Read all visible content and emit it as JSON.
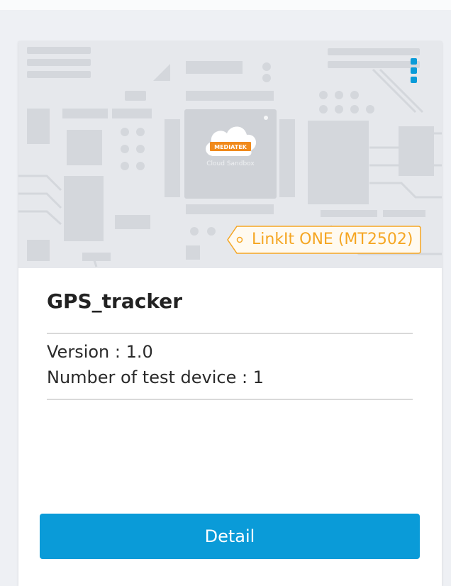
{
  "project": {
    "name": "GPS_tracker",
    "board_label": "LinkIt ONE (MT2502)",
    "logo_brand": "MEDIATEK",
    "logo_subtitle": "Cloud Sandbox",
    "version_text": "Version : 1.0",
    "test_device_text": "Number of test device : 1"
  },
  "actions": {
    "detail_label": "Detail"
  },
  "colors": {
    "accent": "#0a9bd8",
    "badge": "#f5a623",
    "logo_orange": "#f08a1c"
  },
  "icons": {
    "menu": "more-vertical-icon",
    "badge_dot": "circle-icon"
  }
}
